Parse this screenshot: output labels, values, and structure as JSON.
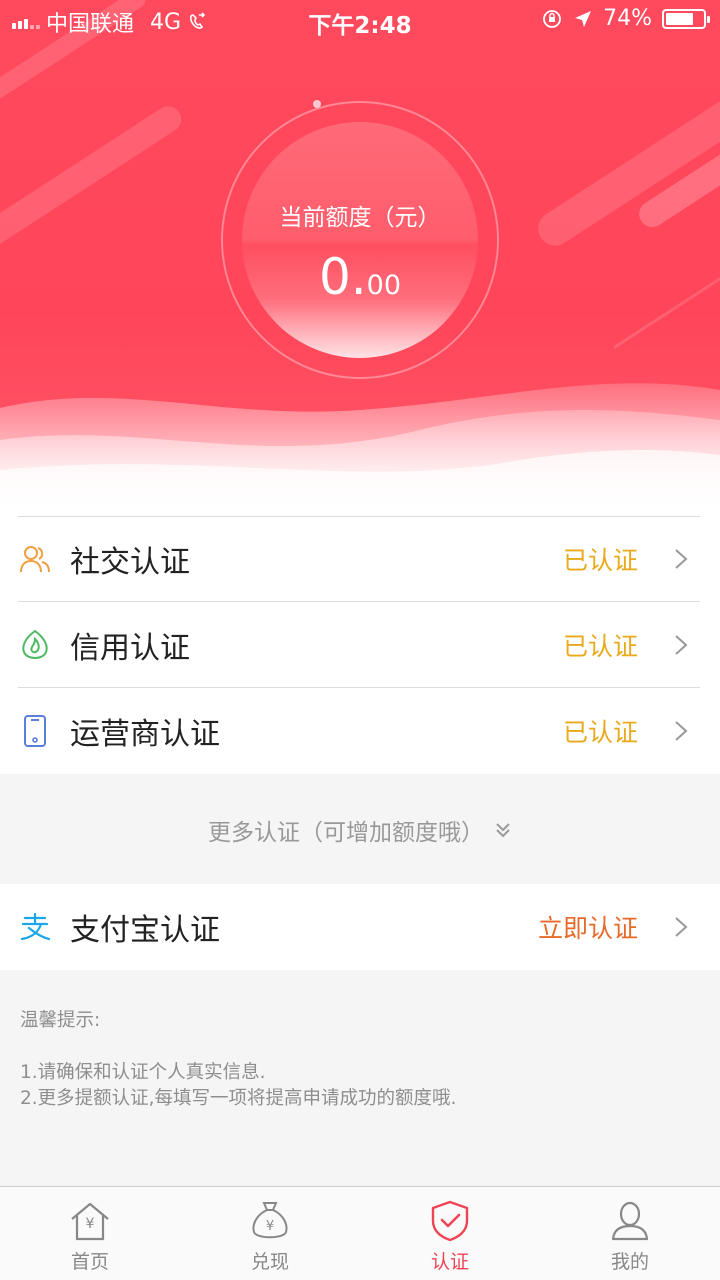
{
  "status_bar": {
    "carrier": "中国联通",
    "network": "4G",
    "time": "下午2:48",
    "battery": "74%",
    "battery_level": 0.74
  },
  "quota": {
    "label": "当前额度（元）",
    "integer": "0.",
    "decimal": "00"
  },
  "certifications": [
    {
      "title": "社交认证",
      "status": "已认证",
      "icon": "people-icon",
      "color": "#f0a040"
    },
    {
      "title": "信用认证",
      "status": "已认证",
      "icon": "credit-icon",
      "color": "#4cb860"
    },
    {
      "title": "运营商认证",
      "status": "已认证",
      "icon": "phone-icon",
      "color": "#5b7fd8"
    }
  ],
  "more": {
    "label": "更多认证（可增加额度哦）"
  },
  "alipay": {
    "title": "支付宝认证",
    "status": "立即认证",
    "icon": "alipay-icon",
    "color": "#1aa7e8"
  },
  "tips": {
    "heading": "温馨提示:",
    "lines": [
      "1.请确保和认证个人真实信息.",
      "2.更多提额认证,每填写一项将提高申请成功的额度哦."
    ]
  },
  "tabs": [
    {
      "label": "首页",
      "icon": "home-icon"
    },
    {
      "label": "兑现",
      "icon": "money-bag-icon"
    },
    {
      "label": "认证",
      "icon": "shield-check-icon",
      "active": true
    },
    {
      "label": "我的",
      "icon": "user-icon"
    }
  ],
  "colors": {
    "brand": "#ff4a5e",
    "verified": "#e8a91b",
    "action": "#e86a2a",
    "tab_active": "#ee4456"
  }
}
